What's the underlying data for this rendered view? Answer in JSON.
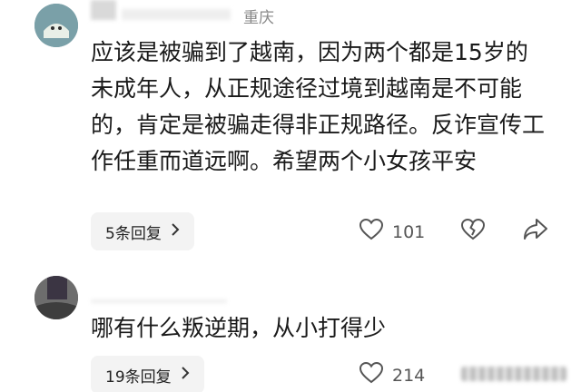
{
  "comments": [
    {
      "location": "重庆",
      "text": "应该是被骗到了越南，因为两个都是15岁的未成年人，从正规途径过境到越南是不可能的，肯定是被骗走得非正规路径。反诈宣传工作任重而道远啊。希望两个小女孩平安",
      "replies_label": "5条回复",
      "likes": "101",
      "icons": {
        "like": "heart-icon",
        "dislike": "broken-heart-icon",
        "share": "share-arrow-icon",
        "chevron": "chevron-right-icon"
      }
    },
    {
      "text": "哪有什么叛逆期，从小打得少",
      "replies_label": "19条回复",
      "likes": "214",
      "icons": {
        "like": "heart-icon",
        "chevron": "chevron-right-icon"
      }
    }
  ]
}
